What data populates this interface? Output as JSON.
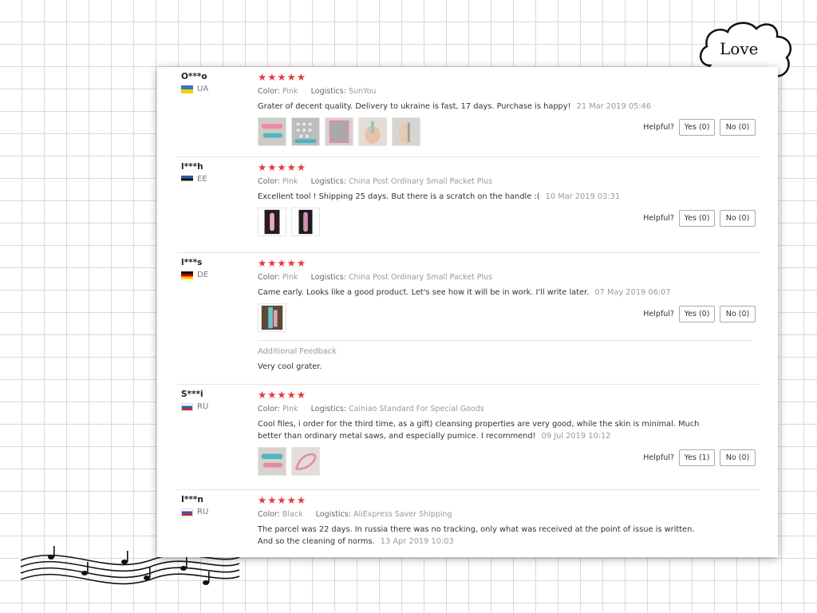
{
  "decor": {
    "love_text": "Love"
  },
  "helpful_label": "Helpful?",
  "reviews": [
    {
      "user": "O***o",
      "country": "UA",
      "stars": "★★★★★",
      "color_label": "Color:",
      "color": "Pink",
      "logistics_label": "Logistics:",
      "logistics": "SunYou",
      "text": "Grater of decent quality. Delivery to ukraine is fast, 17 days. Purchase is happy!",
      "date": "21 Mar 2019 05:46",
      "yes": "Yes (0)",
      "no": "No (0)"
    },
    {
      "user": "l***h",
      "country": "EE",
      "stars": "★★★★★",
      "color_label": "Color:",
      "color": "Pink",
      "logistics_label": "Logistics:",
      "logistics": "China Post Ordinary Small Packet Plus",
      "text": "Excellent tool ! Shipping 25 days. But there is a scratch on the handle :(",
      "date": "10 Mar 2019 03:31",
      "yes": "Yes (0)",
      "no": "No (0)"
    },
    {
      "user": "l***s",
      "country": "DE",
      "stars": "★★★★★",
      "color_label": "Color:",
      "color": "Pink",
      "logistics_label": "Logistics:",
      "logistics": "China Post Ordinary Small Packet Plus",
      "text": "Came early. Looks like a good product. Let's see how it will be in work. I'll write later.",
      "date": "07 May 2019 06:07",
      "yes": "Yes (0)",
      "no": "No (0)",
      "additional_title": "Additional Feedback",
      "additional_text": "Very cool grater."
    },
    {
      "user": "S***i",
      "country": "RU",
      "stars": "★★★★★",
      "color_label": "Color:",
      "color": "Pink",
      "logistics_label": "Logistics:",
      "logistics": "Cainiao Standard For Special Goods",
      "text": "Cool files, i order for the third time, as a gift) cleansing properties are very good, while the skin is minimal. Much better than ordinary metal saws, and especially pumice. I recommend!",
      "date": "09 Jul 2019 10:12",
      "yes": "Yes (1)",
      "no": "No (0)"
    },
    {
      "user": "I***n",
      "country": "RU",
      "stars": "★★★★★",
      "color_label": "Color:",
      "color": "Black",
      "logistics_label": "Logistics:",
      "logistics": "AliExpress Saver Shipping",
      "text": "The parcel was 22 days. In russia there was no tracking, only what was received at the point of issue is written. And so the cleaning of norms.",
      "date": "13 Apr 2019 10:03"
    }
  ]
}
